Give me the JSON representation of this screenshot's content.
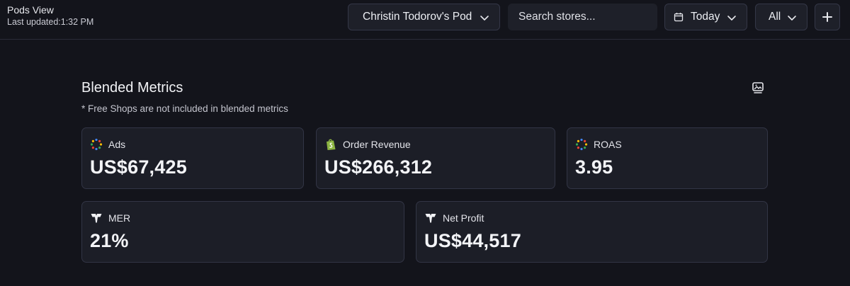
{
  "header": {
    "title": "Pods View",
    "last_updated": "Last updated:1:32 PM",
    "pod_select": "Christin Todorov's Pod",
    "search_placeholder": "Search stores...",
    "date_range": "Today",
    "filter": "All",
    "add_label": "+"
  },
  "metrics": {
    "title": "Blended Metrics",
    "note": "* Free Shops are not included in blended metrics",
    "cards": [
      {
        "label": "Ads",
        "value": "US$67,425",
        "icon": "multi-dot-icon"
      },
      {
        "label": "Order Revenue",
        "value": "US$266,312",
        "icon": "shopify-bag-icon"
      },
      {
        "label": "ROAS",
        "value": "3.95",
        "icon": "multi-dot-icon"
      },
      {
        "label": "MER",
        "value": "21%",
        "icon": "brand-logo-icon"
      },
      {
        "label": "Net Profit",
        "value": "US$44,517",
        "icon": "brand-logo-icon"
      }
    ]
  },
  "colors": {
    "background": "#13141b",
    "card": "#1c1e27",
    "border": "#323545",
    "shopify_green": "#8db543"
  }
}
